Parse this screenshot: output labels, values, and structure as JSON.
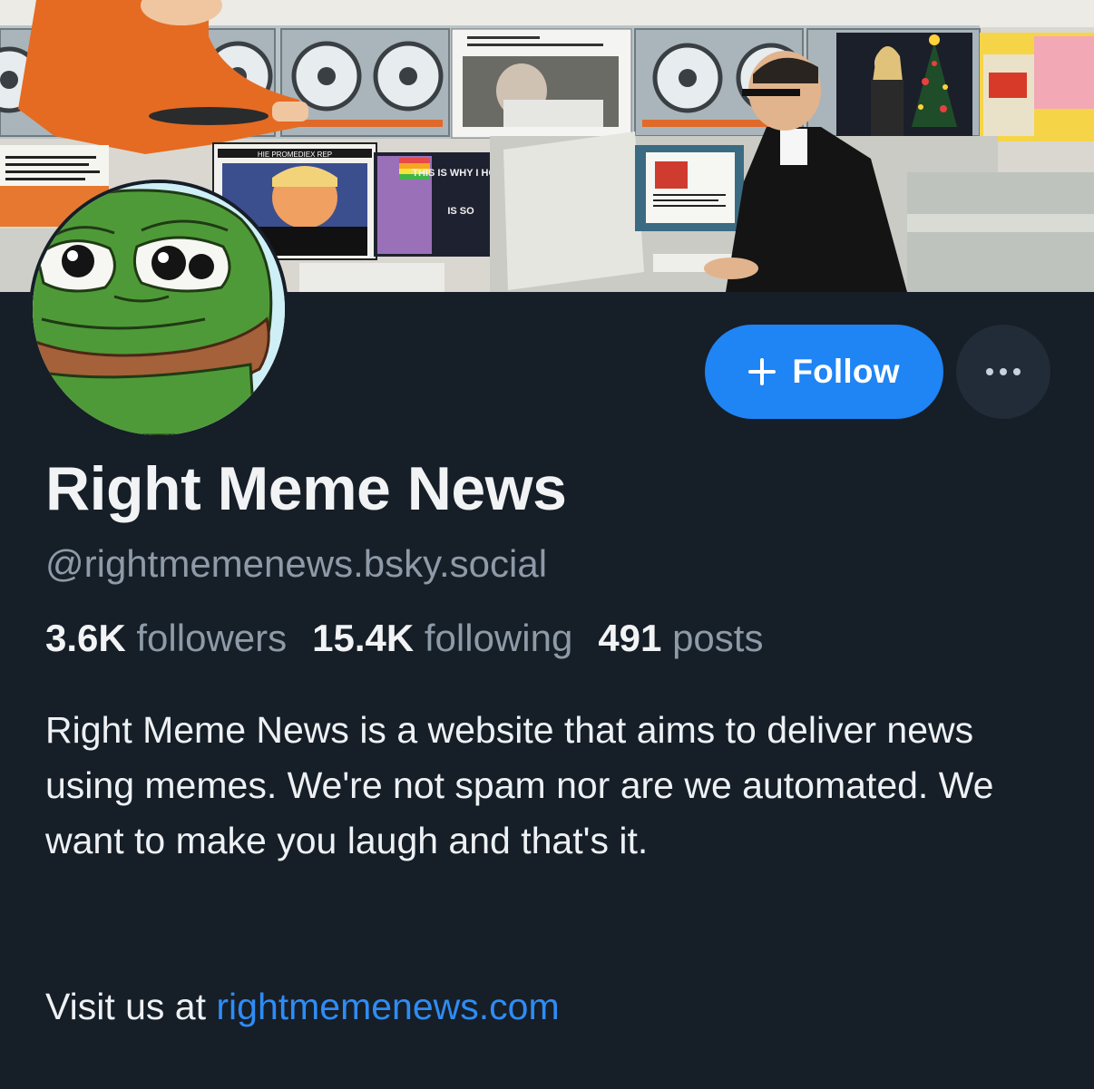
{
  "profile": {
    "display_name": "Right Meme News",
    "handle": "@rightmemenews.bsky.social",
    "bio": "Right Meme News is a website that aims to deliver news using memes. We're not spam nor are we automated. We want to make you laugh and that's it.",
    "visit_prefix": "Visit us at ",
    "website": "rightmemenews.com"
  },
  "stats": {
    "followers_count": "3.6K",
    "followers_label": "followers",
    "following_count": "15.4K",
    "following_label": "following",
    "posts_count": "491",
    "posts_label": "posts"
  },
  "actions": {
    "follow_label": "Follow"
  },
  "banner": {
    "meme_texts": [
      "THIS IS WHY I HOVE",
      "IS SO",
      "HIE PROMEDIEX REP"
    ]
  },
  "colors": {
    "background": "#161e27",
    "accent": "#1f84f4",
    "link": "#2e8cf5",
    "muted_text": "#8e9aa8"
  }
}
